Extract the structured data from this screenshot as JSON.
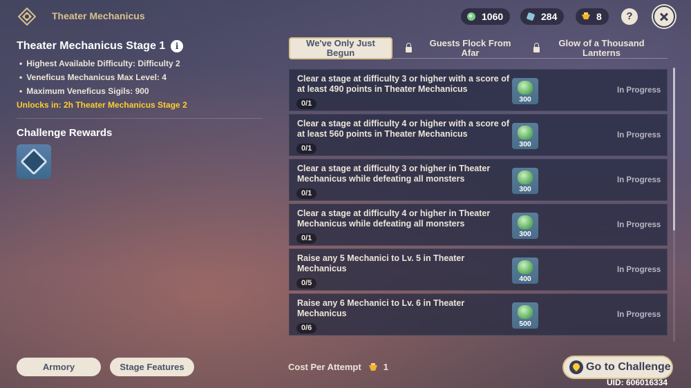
{
  "header": {
    "title": "Theater Mechanicus",
    "currencies": [
      {
        "icon": "primogem-icon",
        "value": "1060"
      },
      {
        "icon": "fate-icon",
        "value": "284"
      },
      {
        "icon": "sigil-icon",
        "value": "8"
      }
    ],
    "help_label": "?"
  },
  "stage": {
    "title": "Theater Mechanicus Stage 1",
    "info_label": "i",
    "details": [
      "Highest Available Difficulty: Difficulty 2",
      "Veneficus Mechanicus Max Level: 4",
      "Maximum Veneficus Sigils: 900"
    ],
    "unlock_text": "Unlocks in: 2h Theater Mechanicus Stage 2"
  },
  "rewards": {
    "title": "Challenge Rewards",
    "items": [
      {
        "icon": "cube-reward-icon"
      }
    ]
  },
  "tabs": [
    {
      "label": "We've Only Just Begun",
      "active": true,
      "locked": false
    },
    {
      "label": "Guests Flock From Afar",
      "active": false,
      "locked": true
    },
    {
      "label": "Glow of a Thousand Lanterns",
      "active": false,
      "locked": true
    }
  ],
  "challenges": [
    {
      "desc": "Clear a stage at difficulty 3 or higher with a score of at least 490 points in Theater Mechanicus",
      "progress": "0/1",
      "reward": "300",
      "status": "In Progress"
    },
    {
      "desc": "Clear a stage at difficulty 4 or higher with a score of at least 560 points in Theater Mechanicus",
      "progress": "0/1",
      "reward": "300",
      "status": "In Progress"
    },
    {
      "desc": "Clear a stage at difficulty 3 or higher in Theater Mechanicus while defeating all monsters",
      "progress": "0/1",
      "reward": "300",
      "status": "In Progress"
    },
    {
      "desc": "Clear a stage at difficulty 4 or higher in Theater Mechanicus while defeating all monsters",
      "progress": "0/1",
      "reward": "300",
      "status": "In Progress"
    },
    {
      "desc": "Raise any 5 Mechanici to Lv. 5 in Theater Mechanicus",
      "progress": "0/5",
      "reward": "400",
      "status": "In Progress"
    },
    {
      "desc": "Raise any 6 Mechanici to Lv. 6 in Theater Mechanicus",
      "progress": "0/6",
      "reward": "500",
      "status": "In Progress"
    }
  ],
  "footer": {
    "armory_label": "Armory",
    "stage_features_label": "Stage Features",
    "cost_label": "Cost Per Attempt",
    "cost_value": "1",
    "go_label": "Go to Challenge",
    "uid": "UID: 606016334"
  }
}
